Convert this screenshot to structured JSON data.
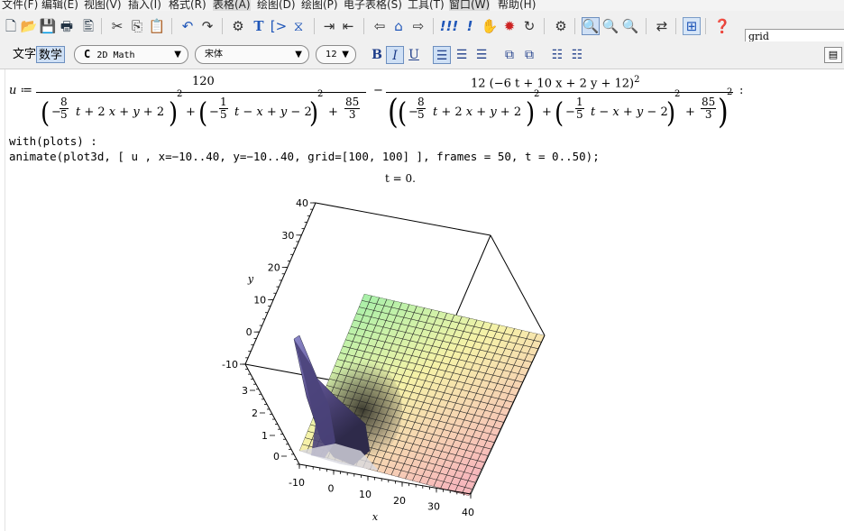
{
  "menu": [
    "文件(F)",
    "编辑(E)",
    "视图(V)",
    "插入(I)",
    "格式(R)",
    "表格(A)",
    "绘图(D)",
    "绘图(P)",
    "电子表格(S)",
    "工具(T)",
    "窗口(W)",
    "帮助(H)"
  ],
  "toolbar": {
    "search_value": "grid"
  },
  "format_bar": {
    "text_mode": "文字",
    "math_mode": "数学",
    "style_prefix": "C",
    "style": "2D Math",
    "font": "宋体",
    "size": "12"
  },
  "document": {
    "u_lhs": "u ≔",
    "numerator1": "120",
    "numerator2": "12 (−6 t + 10 x + 2 y + 12)",
    "frac_8": "8",
    "frac_5": "5",
    "frac_1": "1",
    "frac_85": "85",
    "frac_3": "3",
    "with_cmd": "with(plots) :",
    "animate_cmd": "animate(plot3d, [ u , x=−10..40, y=−10..40, grid=[100, 100] ], frames = 50, t = 0..50);"
  },
  "plot": {
    "title": "t = 0.",
    "x_label": "x",
    "y_label": "y",
    "x_ticks": [
      "-10",
      "0",
      "10",
      "20",
      "30",
      "40"
    ],
    "y_ticks": [
      "40",
      "30",
      "20",
      "10",
      "0",
      "-10"
    ],
    "z_ticks": [
      "3",
      "2",
      "1",
      "0"
    ]
  },
  "colors": {
    "surface_low": "#f7b8bc",
    "surface_mid": "#f6f2a8",
    "surface_high": "#a9f0a9",
    "peak": "#5a4f8c",
    "accent_pressed": "#cfe0f5"
  }
}
